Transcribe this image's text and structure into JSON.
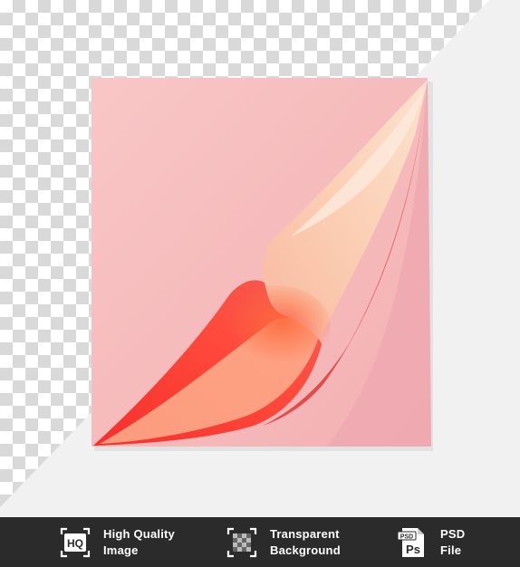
{
  "image": {
    "subject": "curled-pink-paper",
    "colors": {
      "paper": "#f7bcbc",
      "curl": "#f03a36",
      "curl_back": "#fbd2b8",
      "checker": "#d9d9d9",
      "footer": "#2b2b2b"
    }
  },
  "footer": {
    "features": [
      {
        "icon": "hq-icon",
        "line1": "High Quality",
        "line2": "Image"
      },
      {
        "icon": "transparent-background-icon",
        "line1": "Transparent",
        "line2": "Background"
      },
      {
        "icon": "psd-file-icon",
        "line1": "PSD",
        "line2": "File"
      }
    ],
    "icon_texts": {
      "hq": "HQ",
      "psd_tag": "PSD",
      "ps": "Ps"
    }
  }
}
